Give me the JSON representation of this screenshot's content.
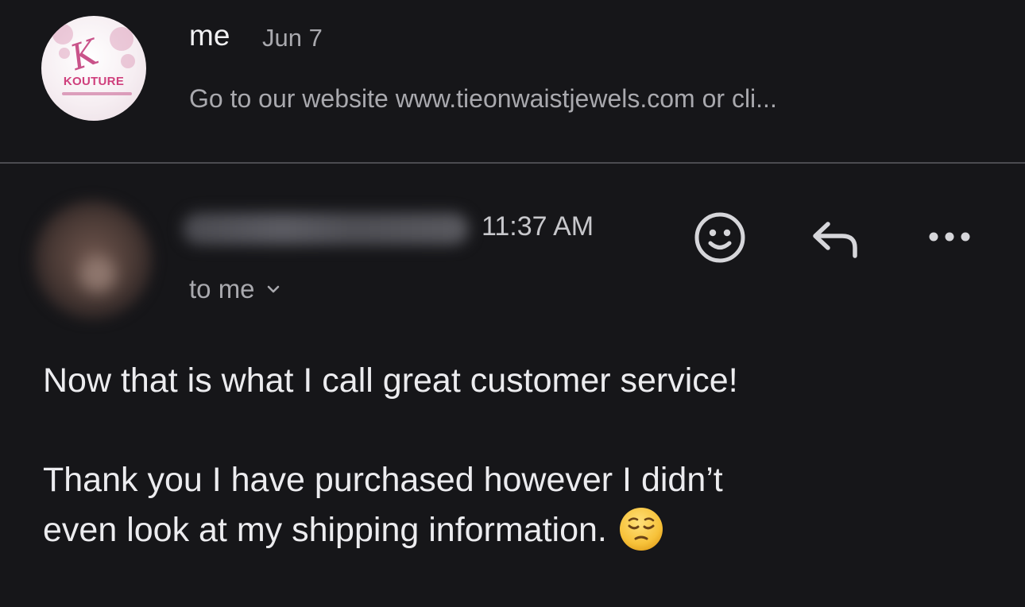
{
  "thread": {
    "collapsed": {
      "sender": "me",
      "date": "Jun 7",
      "snippet": "Go to our website www.tieonwaistjewels.com or cli...",
      "avatar_label": "KOUTURE"
    },
    "expanded": {
      "time": "11:37 AM",
      "recipient_label": "to me",
      "actions": {
        "emoji_icon": "smiley-face-icon",
        "reply_icon": "reply-arrow-icon",
        "more_icon": "more-dots-icon"
      },
      "body": {
        "line1": "Now that is what I call great customer service!",
        "line2": "Thank you I have purchased however I didn’t",
        "line3": "even look at my shipping information.",
        "emoji": "pensive-face-emoji"
      }
    }
  },
  "colors": {
    "background": "#161619",
    "primary_text": "#ececef",
    "secondary_text": "#a9a9ae",
    "divider": "#4b4b50",
    "brand_pink": "#cf3f7c"
  }
}
